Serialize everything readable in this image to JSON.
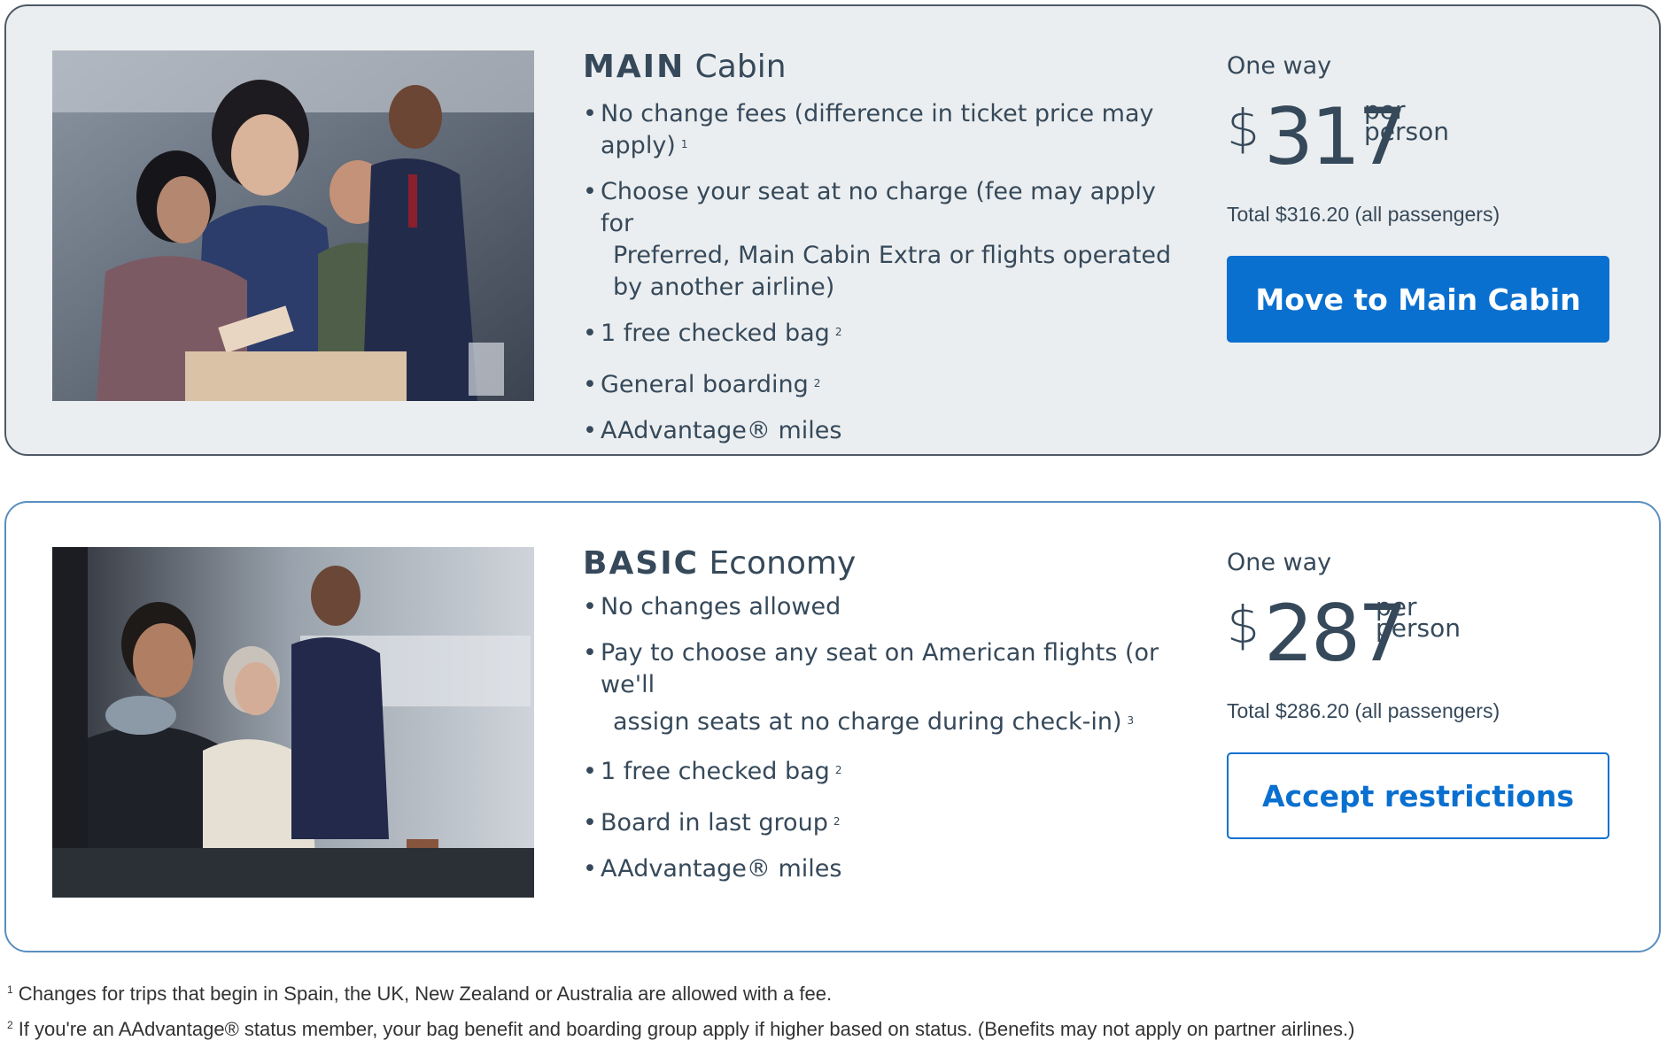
{
  "colors": {
    "main_card_bg": "#ebeef0",
    "primary_blue": "#0a70d0",
    "text": "#36495a"
  },
  "main_cabin": {
    "brand": "MAIN",
    "name": "Cabin",
    "features": [
      {
        "text": "No change fees (difference in ticket price may apply)",
        "note": "1",
        "cont": ""
      },
      {
        "text": "Choose your seat at no charge (fee may apply for",
        "note": "",
        "cont": "Preferred, Main Cabin Extra or flights operated by another airline)"
      },
      {
        "text": "1 free checked bag",
        "note": "2",
        "cont": ""
      },
      {
        "text": "General boarding",
        "note": "2",
        "cont": ""
      },
      {
        "text": "AAdvantage® miles",
        "note": "",
        "cont": ""
      }
    ],
    "one_way": "One way",
    "currency": "$",
    "price": "317",
    "per_1": "per",
    "per_2": "person",
    "total": "Total $316.20 (all passengers)",
    "button": "Move to Main Cabin"
  },
  "basic_economy": {
    "brand": "BASIC",
    "name": "Economy",
    "features": [
      {
        "text": "No changes allowed",
        "note": "",
        "cont": ""
      },
      {
        "text": "Pay to choose any seat on American flights (or we'll",
        "note": "",
        "cont": "assign seats at no charge during check-in)",
        "cont_note": "3"
      },
      {
        "text": "1 free checked bag",
        "note": "2",
        "cont": ""
      },
      {
        "text": "Board in last group",
        "note": "2",
        "cont": ""
      },
      {
        "text": "AAdvantage® miles",
        "note": "",
        "cont": ""
      }
    ],
    "one_way": "One way",
    "currency": "$",
    "price": "287",
    "per_1": "per",
    "per_2": "person",
    "total": "Total $286.20 (all passengers)",
    "button": "Accept restrictions"
  },
  "footnotes": [
    {
      "num": "1",
      "text": "Changes for trips that begin in Spain, the UK, New Zealand or Australia are allowed with a fee."
    },
    {
      "num": "2",
      "text": "If you're an AAdvantage® status member, your bag benefit and boarding group apply if higher based on status. (Benefits may not apply on partner airlines.)"
    }
  ],
  "icons": {
    "main_photo": "cabin-passengers-photo",
    "basic_photo": "economy-passengers-photo"
  }
}
